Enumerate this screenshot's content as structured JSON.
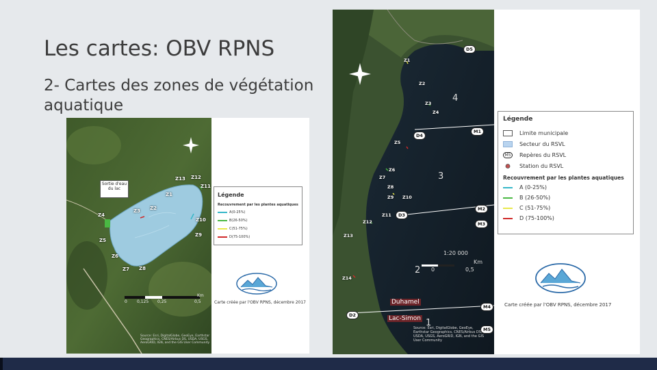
{
  "slide": {
    "title": "Les cartes: OBV RPNS",
    "subtitle": "2- Cartes des zones de végétation aquatique"
  },
  "map1": {
    "callout": "Sortie d'eau du lac",
    "zones": [
      "Z1",
      "Z2",
      "Z3",
      "Z4",
      "Z5",
      "Z6",
      "Z7",
      "Z8",
      "Z9",
      "Z10",
      "Z11",
      "Z12",
      "Z13"
    ],
    "legend": {
      "title": "Légende",
      "subtitle": "Recouvrement par les plantes aquatiques",
      "items": [
        {
          "label": "A(0-25%)",
          "color": "#35b7c8"
        },
        {
          "label": "B(26-50%)",
          "color": "#4ab843"
        },
        {
          "label": "C(51-75%)",
          "color": "#e8e84a"
        },
        {
          "label": "D(75-100%)",
          "color": "#d02a2a"
        }
      ]
    },
    "scale": {
      "unit": "Km",
      "ticks": [
        "0",
        "0,125",
        "0,25",
        "0,5"
      ]
    },
    "credit": "Carte créée par l'OBV RPNS, décembre 2017",
    "source": "Source: Esri, DigitalGlobe, GeoEye, Earthstar Geographics, CNES/Airbus DS, USDA, USGS, AeroGRID, IGN, and the GIS User Community"
  },
  "map2": {
    "zones": [
      "Z1",
      "Z2",
      "Z3",
      "Z4",
      "Z5",
      "Z6",
      "Z7",
      "Z8",
      "Z9",
      "Z10",
      "Z11",
      "Z12",
      "Z13",
      "Z14"
    ],
    "markers": [
      "D5",
      "D4",
      "D3",
      "D2",
      "M1",
      "M2",
      "M3",
      "M4",
      "M5"
    ],
    "sectors": [
      "1",
      "2",
      "3",
      "4"
    ],
    "places": [
      "Duhamel",
      "Lac-Simon"
    ],
    "legend": {
      "title": "Légende",
      "items": [
        {
          "label": "Limite municipale",
          "symbol": "box-white"
        },
        {
          "label": "Secteur du RSVL",
          "symbol": "box-blue"
        },
        {
          "label": "Repères du RSVL",
          "symbol": "M5"
        },
        {
          "label": "Station du RSVL",
          "symbol": "dot"
        }
      ],
      "subtitle": "Recouvrement par les plantes aquatiques",
      "cover": [
        {
          "label": "A (0-25%)",
          "color": "#35b7c8"
        },
        {
          "label": "B (26-50%)",
          "color": "#4ab843"
        },
        {
          "label": "C (51-75%)",
          "color": "#e8e84a"
        },
        {
          "label": "D (75-100%)",
          "color": "#d02a2a"
        }
      ]
    },
    "scale": {
      "ratio": "1:20 000",
      "unit": "Km",
      "ticks": [
        "0",
        "0,5"
      ]
    },
    "credit": "Carte créée par l'OBV RPNS, décembre 2017",
    "source": "Source: Esri, DigitalGlobe, GeoEye, Earthstar Geographics, CNES/Airbus DS, USDA, USGS, AeroGRID, IGN, and the GIS User Community"
  }
}
